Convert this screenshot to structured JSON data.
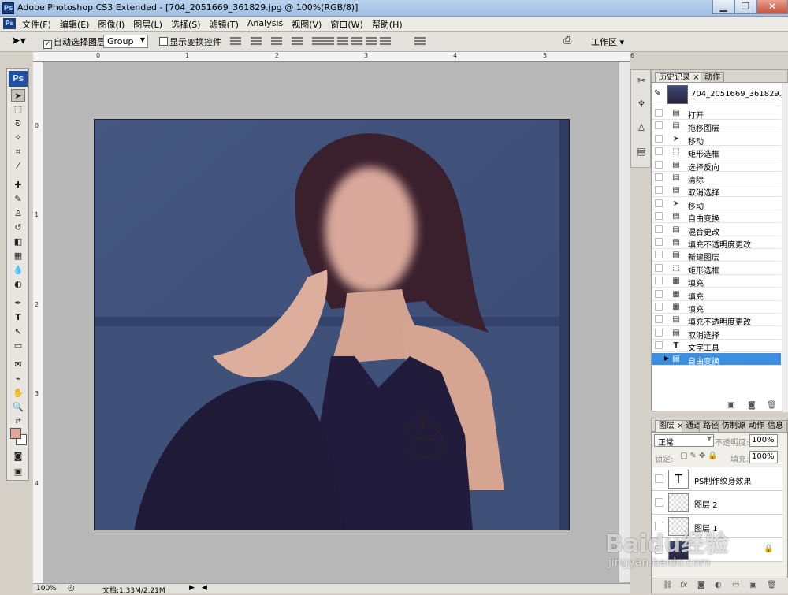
{
  "window": {
    "title": "Adobe Photoshop CS3 Extended - [704_2051669_361829.jpg @ 100%(RGB/8)]",
    "app_logo": "Ps",
    "controls": [
      "minimize-icon",
      "maximize-icon",
      "close-icon"
    ]
  },
  "menubar": {
    "items": [
      "文件(F)",
      "编辑(E)",
      "图像(I)",
      "图层(L)",
      "选择(S)",
      "滤镜(T)",
      "Analysis",
      "视图(V)",
      "窗口(W)",
      "帮助(H)"
    ]
  },
  "options": {
    "auto_select_label": "自动选择图层",
    "auto_select_checked": true,
    "group_value": "Group",
    "show_transform_label": "显示变换控件",
    "show_transform_checked": false,
    "workspace_label": "工作区"
  },
  "rulers": {
    "top": [
      "0",
      "1",
      "2",
      "3",
      "4",
      "5",
      "6"
    ],
    "left": [
      "0",
      "1",
      "2",
      "3",
      "4"
    ]
  },
  "status": {
    "zoom": "100%",
    "doc_info": "文档:1.33M/2.21M"
  },
  "history": {
    "tabs": [
      "历史记录",
      "动作"
    ],
    "snapshot_name": "704_2051669_361829.jpg",
    "items": [
      {
        "label": "打开",
        "icon": "doc-icon"
      },
      {
        "label": "拖移图层",
        "icon": "doc-icon"
      },
      {
        "label": "移动",
        "icon": "move-icon"
      },
      {
        "label": "矩形选框",
        "icon": "marquee-icon"
      },
      {
        "label": "选择反向",
        "icon": "doc-icon"
      },
      {
        "label": "清除",
        "icon": "doc-icon"
      },
      {
        "label": "取消选择",
        "icon": "doc-icon"
      },
      {
        "label": "移动",
        "icon": "move-icon"
      },
      {
        "label": "自由变换",
        "icon": "doc-icon"
      },
      {
        "label": "混合更改",
        "icon": "doc-icon"
      },
      {
        "label": "填充不透明度更改",
        "icon": "doc-icon"
      },
      {
        "label": "新建图层",
        "icon": "doc-icon"
      },
      {
        "label": "矩形选框",
        "icon": "marquee-icon"
      },
      {
        "label": "填充",
        "icon": "fill-icon"
      },
      {
        "label": "填充",
        "icon": "fill-icon"
      },
      {
        "label": "填充",
        "icon": "fill-icon"
      },
      {
        "label": "填充不透明度更改",
        "icon": "doc-icon"
      },
      {
        "label": "取消选择",
        "icon": "doc-icon"
      },
      {
        "label": "文字工具",
        "icon": "type-icon"
      },
      {
        "label": "自由变换",
        "icon": "doc-icon",
        "selected": true
      }
    ]
  },
  "layers": {
    "tabs": [
      "图层",
      "通道",
      "路径",
      "仿制源",
      "动作",
      "信息"
    ],
    "blend_mode": "正常",
    "opacity_label": "不透明度:",
    "opacity_value": "100%",
    "lock_label": "锁定:",
    "fill_label": "填充:",
    "fill_value": "100%",
    "items": [
      {
        "name": "PS制作纹身效果",
        "thumb": "T",
        "type": "text"
      },
      {
        "name": "图层 2",
        "thumb": "",
        "type": "transparent"
      },
      {
        "name": "图层 1",
        "thumb": "",
        "type": "transparent"
      },
      {
        "name": "",
        "thumb": "",
        "type": "photo"
      }
    ]
  },
  "watermark": {
    "line1": "Baidu经验",
    "line2": "jingyan.baidu.com"
  },
  "colors": {
    "foreground": "#e0a89a",
    "background": "#ffffff",
    "selection": "#3d8fe0"
  }
}
